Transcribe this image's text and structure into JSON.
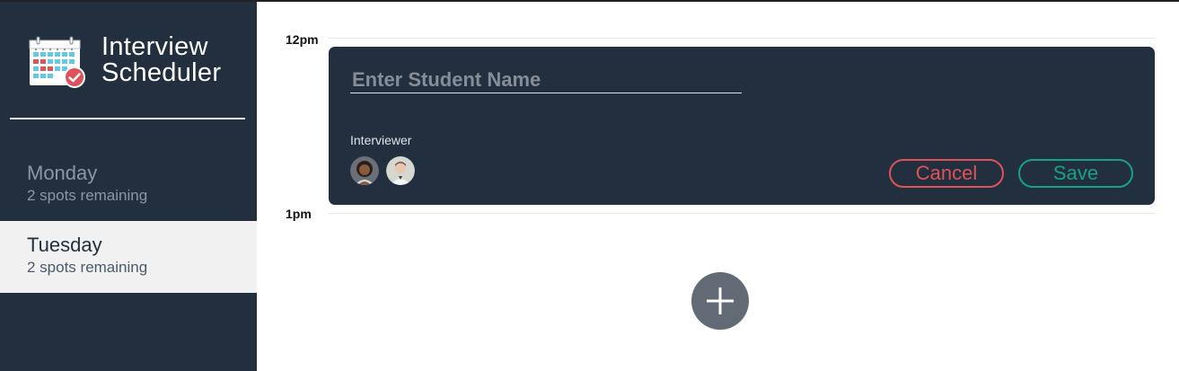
{
  "app": {
    "title_line1": "Interview",
    "title_line2": "Scheduler",
    "logo_icon": "calendar-check-icon"
  },
  "sidebar": {
    "days": [
      {
        "name": "Monday",
        "spots": "2 spots remaining",
        "selected": false
      },
      {
        "name": "Tuesday",
        "spots": "2 spots remaining",
        "selected": true
      }
    ]
  },
  "schedule": {
    "times": [
      "12pm",
      "1pm"
    ],
    "form": {
      "student_name_value": "",
      "student_name_placeholder": "Enter Student Name",
      "interviewer_label": "Interviewer",
      "interviewers": [
        {
          "icon": "interviewer-avatar-1"
        },
        {
          "icon": "interviewer-avatar-2"
        }
      ],
      "cancel_label": "Cancel",
      "save_label": "Save"
    },
    "add_icon": "plus-icon"
  },
  "colors": {
    "sidebar_bg": "#222f3e",
    "selected_bg": "#f1f1f1",
    "cancel": "#e0525a",
    "save": "#19a184",
    "add_button": "#626a75"
  }
}
